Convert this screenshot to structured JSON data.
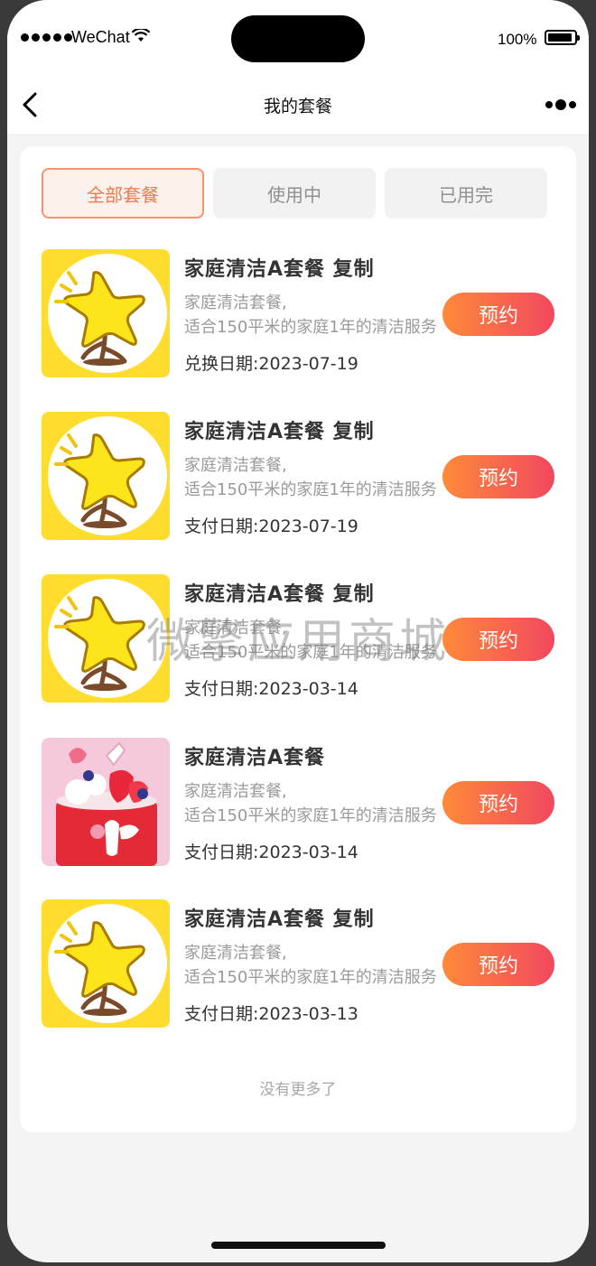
{
  "status_bar": {
    "carrier": "WeChat",
    "battery": "100%"
  },
  "nav": {
    "title": "我的套餐"
  },
  "tabs": [
    {
      "label": "全部套餐",
      "active": true
    },
    {
      "label": "使用中",
      "active": false
    },
    {
      "label": "已用完",
      "active": false
    }
  ],
  "items": [
    {
      "title": "家庭清洁A套餐 复制",
      "desc_line1": "家庭清洁套餐,",
      "desc_line2": "适合150平米的家庭1年的清洁服务",
      "date": "兑换日期:2023-07-19",
      "button": "预约",
      "image": "star-tree-icon"
    },
    {
      "title": "家庭清洁A套餐 复制",
      "desc_line1": "家庭清洁套餐,",
      "desc_line2": "适合150平米的家庭1年的清洁服务",
      "date": "支付日期:2023-07-19",
      "button": "预约",
      "image": "star-tree-icon"
    },
    {
      "title": "家庭清洁A套餐 复制",
      "desc_line1": "家庭清洁套餐,",
      "desc_line2": "适合150平米的家庭1年的清洁服务",
      "date": "支付日期:2023-03-14",
      "button": "预约",
      "image": "star-tree-icon"
    },
    {
      "title": "家庭清洁A套餐",
      "desc_line1": "家庭清洁套餐,",
      "desc_line2": "适合150平米的家庭1年的清洁服务",
      "date": "支付日期:2023-03-14",
      "button": "预约",
      "image": "strawberry-cake-photo"
    },
    {
      "title": "家庭清洁A套餐 复制",
      "desc_line1": "家庭清洁套餐,",
      "desc_line2": "适合150平米的家庭1年的清洁服务",
      "date": "支付日期:2023-03-13",
      "button": "预约",
      "image": "star-tree-icon"
    }
  ],
  "footer": {
    "no_more": "没有更多了"
  },
  "watermark": "微擎应用商城",
  "colors": {
    "accent": "#f07a4b",
    "button_start": "#ff8a3a",
    "button_end": "#f2475f"
  }
}
